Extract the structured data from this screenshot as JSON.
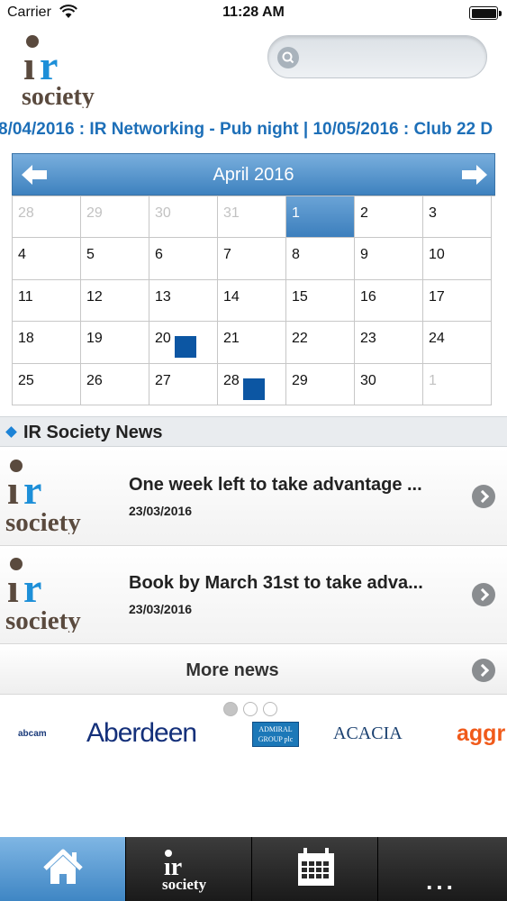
{
  "status": {
    "carrier": "Carrier",
    "time": "11:28 AM"
  },
  "header": {
    "logo_text_top": "ir",
    "logo_text_bottom": "society",
    "search_placeholder": ""
  },
  "ticker": {
    "text": "8/04/2016 : IR Networking - Pub night   |   10/05/2016 : Club 22 D"
  },
  "calendar": {
    "month": "April 2016",
    "days": [
      {
        "d": "28",
        "other": true
      },
      {
        "d": "29",
        "other": true
      },
      {
        "d": "30",
        "other": true
      },
      {
        "d": "31",
        "other": true
      },
      {
        "d": "1",
        "today": true
      },
      {
        "d": "2"
      },
      {
        "d": "3"
      },
      {
        "d": "4"
      },
      {
        "d": "5"
      },
      {
        "d": "6"
      },
      {
        "d": "7"
      },
      {
        "d": "8"
      },
      {
        "d": "9"
      },
      {
        "d": "10"
      },
      {
        "d": "11"
      },
      {
        "d": "12"
      },
      {
        "d": "13"
      },
      {
        "d": "14"
      },
      {
        "d": "15"
      },
      {
        "d": "16"
      },
      {
        "d": "17"
      },
      {
        "d": "18"
      },
      {
        "d": "19"
      },
      {
        "d": "20",
        "event": true
      },
      {
        "d": "21"
      },
      {
        "d": "22"
      },
      {
        "d": "23"
      },
      {
        "d": "24"
      },
      {
        "d": "25"
      },
      {
        "d": "26"
      },
      {
        "d": "27"
      },
      {
        "d": "28",
        "event": true
      },
      {
        "d": "29"
      },
      {
        "d": "30"
      },
      {
        "d": "1",
        "other": true
      }
    ]
  },
  "news": {
    "title": "IR Society News",
    "items": [
      {
        "headline": "One week left to take advantage ...",
        "date": "23/03/2016"
      },
      {
        "headline": "Book by March 31st to take adva...",
        "date": "23/03/2016"
      }
    ],
    "more_label": "More news"
  },
  "sponsors": {
    "names": [
      "abcam",
      "Aberdeen",
      "ADMIRAL GROUP plc",
      "ACACIA",
      "aggr"
    ]
  },
  "colors": {
    "accent": "#1d6fb8",
    "event": "#0c56a3",
    "tab_active": "#4f93cc"
  },
  "tabs": [
    {
      "name": "home",
      "icon": "home-icon"
    },
    {
      "name": "ir-society",
      "icon": "ir-society-logo"
    },
    {
      "name": "calendar",
      "icon": "calendar-icon"
    },
    {
      "name": "more",
      "label": "..."
    }
  ]
}
